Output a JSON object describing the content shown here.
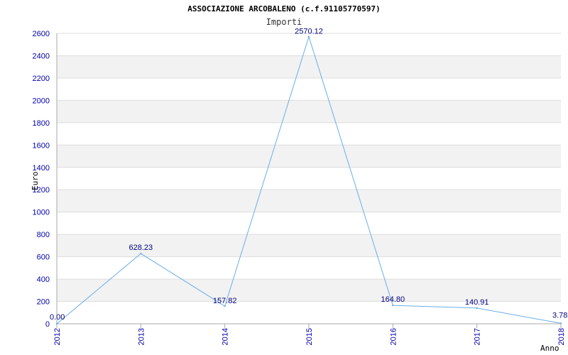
{
  "chart_data": {
    "type": "line",
    "title": "ASSOCIAZIONE ARCOBALENO (c.f.91105770597)",
    "subtitle": "Importi",
    "xlabel": "Anno",
    "ylabel": "Euro",
    "categories": [
      "2012",
      "2013",
      "2014",
      "2015",
      "2016",
      "2017",
      "2018"
    ],
    "values": [
      0.0,
      628.23,
      157.82,
      2570.12,
      164.8,
      140.91,
      3.78
    ],
    "data_labels": [
      "0.00",
      "628.23",
      "157.82",
      "2570.12",
      "164.80",
      "140.91",
      "3.78"
    ],
    "yticks": [
      0,
      200,
      400,
      600,
      800,
      1000,
      1200,
      1400,
      1600,
      1800,
      2000,
      2200,
      2400,
      2600
    ],
    "ylim": [
      0,
      2600
    ],
    "grid": true,
    "colors": {
      "line": "#6aaee8",
      "band": "#f2f2f2",
      "grid": "#dddddd",
      "tick_text": "#0000aa",
      "label_text": "#000080"
    }
  }
}
